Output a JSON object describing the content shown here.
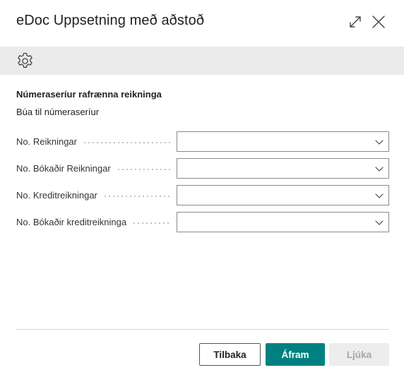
{
  "dialog": {
    "title": "eDoc Uppsetning með aðstoð",
    "expand_icon": "expand-icon",
    "close_icon": "close-icon"
  },
  "toolbar": {
    "settings_icon": "gear-icon"
  },
  "section": {
    "title": "Númeraseríur rafrænna reikninga",
    "subtitle": "Búa til númeraseríur"
  },
  "fields": [
    {
      "label": "No. Reikningar",
      "value": ""
    },
    {
      "label": "No. Bókaðir Reikningar",
      "value": ""
    },
    {
      "label": "No. Kreditreikningar",
      "value": ""
    },
    {
      "label": "No. Bókaðir kreditreikninga",
      "value": ""
    }
  ],
  "footer": {
    "back_label": "Tilbaka",
    "next_label": "Áfram",
    "finish_label": "Ljúka"
  },
  "colors": {
    "primary": "#008080",
    "toolbar_bg": "#ebebeb",
    "disabled_bg": "#ededed",
    "disabled_text": "#a6a6a6"
  }
}
